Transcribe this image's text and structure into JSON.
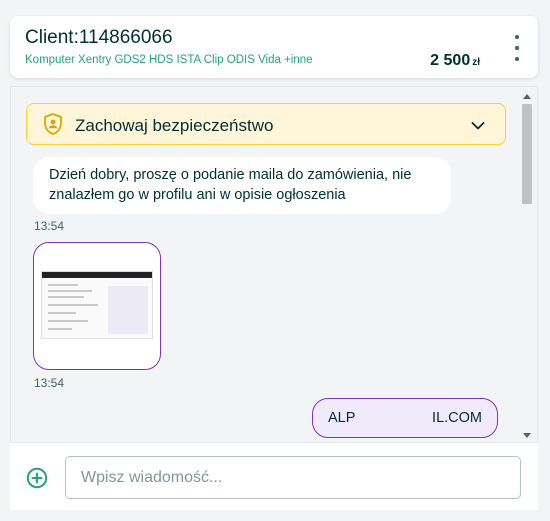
{
  "header": {
    "title": "Client:114866066",
    "subtitle": "Komputer Xentry GDS2 HDS ISTA Clip ODIS Vida +inne",
    "price": "2 500",
    "currency": "zł",
    "menu_icon": "kebab-menu-icon"
  },
  "safety_banner": {
    "label": "Zachowaj bezpieczeństwo",
    "icon": "shield-user-icon",
    "expand_icon": "chevron-down-icon"
  },
  "messages": [
    {
      "direction": "incoming",
      "text": "Dzień dobry, proszę o podanie maila do zamówienia, nie znalazłem go w profilu ani w opisie ogłoszenia",
      "time": "13:54"
    },
    {
      "direction": "incoming",
      "type": "image",
      "time": "13:54"
    },
    {
      "direction": "outgoing",
      "text_start": "ALP",
      "text_end": "IL.COM"
    }
  ],
  "composer": {
    "placeholder": "Wpisz wiadomość...",
    "add_icon": "plus-circle-icon"
  },
  "colors": {
    "accent_green": "#23a27c",
    "own_message_border": "#7f35b2",
    "safety_border": "#ffce32",
    "safety_bg": "#fff6d9",
    "text": "#002f34"
  }
}
